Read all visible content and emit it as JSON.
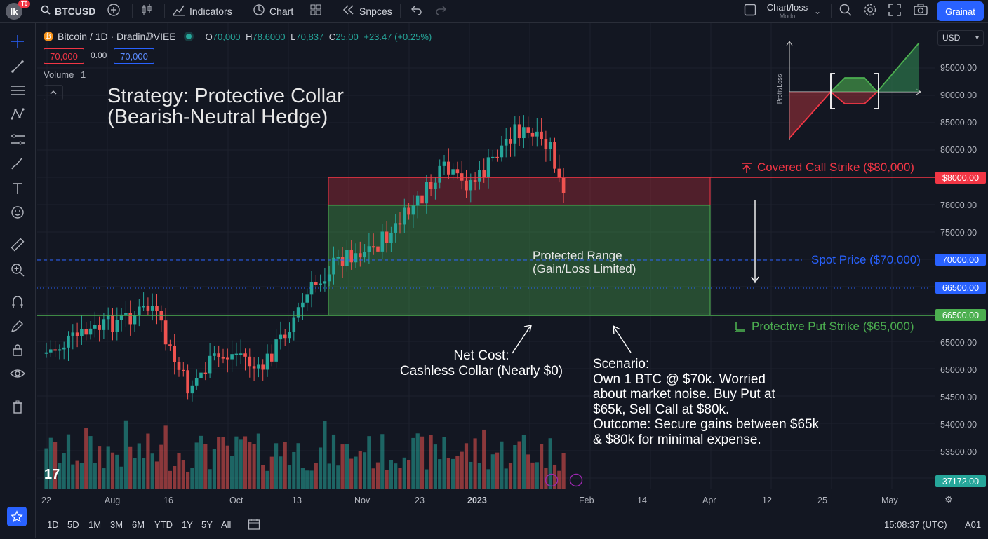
{
  "topbar": {
    "logo_text": "Ik",
    "logo_badge": "T0",
    "symbol": "BTCUSD",
    "indicators_label": "Indicators",
    "chart_label": "Chart",
    "snapshots_label": "Snpces",
    "chart_type_label": "Chart/loss",
    "chart_type_sub": "Modo",
    "publish_label": "Grainat"
  },
  "legend": {
    "instrument": "Bitcoin / 1D · DradinⅅVIEE",
    "o_label": "O",
    "o_value": "70,000",
    "h_label": "H",
    "h_value": "78.6000",
    "l_label": "L",
    "l_value": "70,837",
    "c_label": "C",
    "c_value": "25.00",
    "change": "+23.47 (+0.25%)",
    "sell_price": "70,000",
    "spread": "0.00",
    "buy_price": "70,000",
    "volume_label": "Volume",
    "volume_value": "1",
    "collapse_icon": "chevron-up-icon"
  },
  "annotations": {
    "title_line1": "Strategy: Protective Collar",
    "title_line2": "(Bearish-Neutral Hedge)",
    "call_label": "Covered Call Strike ($80,000)",
    "spot_label": "Spot Price ($70,000)",
    "put_label": "Protective Put Strike ($65,000)",
    "range_line1": "Protected Range",
    "range_line2": "(Gain/Loss Limited)",
    "net_cost_line1": "Net Cost:",
    "net_cost_line2": "Cashless Collar (Nearly $0)",
    "scenario_lines": [
      "Scenario:",
      "Own 1 BTC @ $70k. Worried",
      "about market noise. Buy Put at",
      "$65k, Sell Call at $80k.",
      "Outcome: Secure gains between $65k",
      "& $80k for minimal expense."
    ],
    "payoff_ylabel": "Profit/Loss"
  },
  "price_axis": {
    "currency": "USD",
    "labels": [
      "95000.00",
      "90000.00",
      "85000.00",
      "80000.00",
      "78000.00",
      "75000.00",
      "65000.00",
      "65000.00",
      "54500.00",
      "54000.00",
      "53500.00"
    ],
    "tags": {
      "call": "$8000.00",
      "spot": "70000.00",
      "mid": "66500.00",
      "put": "66500.00",
      "last": "37172.00"
    }
  },
  "time_axis": {
    "labels": [
      "22",
      "Aug",
      "16",
      "Oct",
      "13",
      "Nov",
      "23",
      "2023",
      "Feb",
      "14",
      "Apr",
      "12",
      "25",
      "May"
    ]
  },
  "bottombar": {
    "ranges": [
      "1D",
      "5D",
      "1M",
      "3M",
      "6M",
      "YTD",
      "1Y",
      "5Y",
      "All"
    ],
    "clock": "15:08:37 (UTC)",
    "adj": "A01"
  },
  "colors": {
    "bg": "#131722",
    "up": "#26a69a",
    "down": "#ef5350",
    "call": "#f23645",
    "put": "#4caf50",
    "spot": "#2962ff"
  },
  "chart_data": {
    "type": "candlestick",
    "series": [
      {
        "name": "Bitcoin / 1D",
        "ohlc": []
      }
    ]
  }
}
